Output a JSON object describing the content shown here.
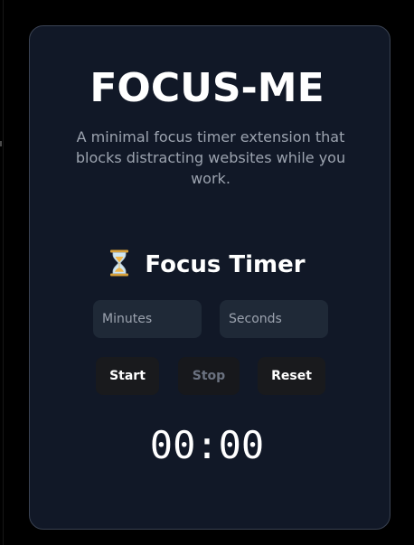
{
  "app": {
    "title": "FOCUS-ME",
    "description": "A minimal focus timer extension that blocks distracting websites while you work."
  },
  "timer_section": {
    "icon": "hourglass-icon",
    "heading": "Focus Timer",
    "minutes_placeholder": "Minutes",
    "seconds_placeholder": "Seconds",
    "start_label": "Start",
    "stop_label": "Stop",
    "reset_label": "Reset",
    "display": "00:00"
  },
  "colors": {
    "page_background": "#000000",
    "card_background": "#111827",
    "card_border": "#3a4252",
    "input_background": "#1f2937",
    "button_background": "#191a1d",
    "text_primary": "#ffffff",
    "text_muted": "#9ca3af",
    "disabled_text": "#6b7280"
  }
}
